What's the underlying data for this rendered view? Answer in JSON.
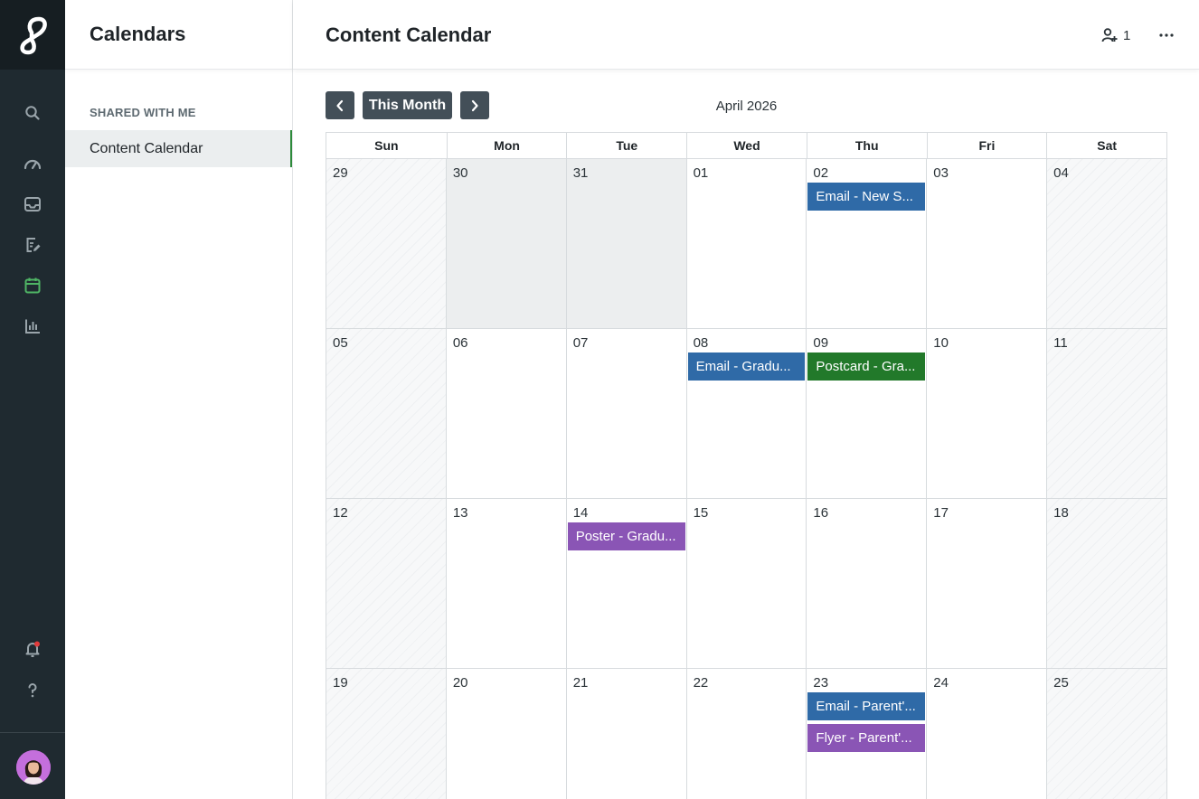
{
  "sidebar": {
    "title": "Calendars",
    "section_label": "SHARED WITH ME",
    "items": [
      {
        "label": "Content Calendar"
      }
    ]
  },
  "rail": {
    "icons": [
      "logo-icon",
      "search-icon",
      "dashboard-gauge-icon",
      "inbox-icon",
      "edit-document-icon",
      "calendar-icon",
      "bar-chart-icon",
      "notification-bell-icon",
      "help-icon"
    ],
    "active_icon": "calendar-icon",
    "active_color": "#4fb565"
  },
  "header": {
    "title": "Content Calendar",
    "share_count": "1"
  },
  "toolbar": {
    "prev_icon": "chevron-left-icon",
    "this_month_label": "This Month",
    "next_icon": "chevron-right-icon",
    "month_label": "April 2026"
  },
  "calendar": {
    "weekdays": [
      "Sun",
      "Mon",
      "Tue",
      "Wed",
      "Thu",
      "Fri",
      "Sat"
    ],
    "weeks": [
      [
        {
          "day": "29",
          "type": "weekend",
          "events": []
        },
        {
          "day": "30",
          "type": "past",
          "events": []
        },
        {
          "day": "31",
          "type": "past",
          "events": []
        },
        {
          "day": "01",
          "type": "normal",
          "events": []
        },
        {
          "day": "02",
          "type": "normal",
          "events": [
            {
              "label": "Email - New S...",
              "color": "blue"
            }
          ]
        },
        {
          "day": "03",
          "type": "normal",
          "events": []
        },
        {
          "day": "04",
          "type": "weekend",
          "events": []
        }
      ],
      [
        {
          "day": "05",
          "type": "weekend",
          "events": []
        },
        {
          "day": "06",
          "type": "normal",
          "events": []
        },
        {
          "day": "07",
          "type": "normal",
          "events": []
        },
        {
          "day": "08",
          "type": "normal",
          "events": [
            {
              "label": "Email - Gradu...",
              "color": "blue"
            }
          ]
        },
        {
          "day": "09",
          "type": "normal",
          "events": [
            {
              "label": "Postcard - Gra...",
              "color": "green"
            }
          ]
        },
        {
          "day": "10",
          "type": "normal",
          "events": []
        },
        {
          "day": "11",
          "type": "weekend",
          "events": []
        }
      ],
      [
        {
          "day": "12",
          "type": "weekend",
          "events": []
        },
        {
          "day": "13",
          "type": "normal",
          "events": []
        },
        {
          "day": "14",
          "type": "normal",
          "events": [
            {
              "label": "Poster - Gradu...",
              "color": "purple"
            }
          ]
        },
        {
          "day": "15",
          "type": "normal",
          "events": []
        },
        {
          "day": "16",
          "type": "normal",
          "events": []
        },
        {
          "day": "17",
          "type": "normal",
          "events": []
        },
        {
          "day": "18",
          "type": "weekend",
          "events": []
        }
      ],
      [
        {
          "day": "19",
          "type": "weekend",
          "events": []
        },
        {
          "day": "20",
          "type": "normal",
          "events": []
        },
        {
          "day": "21",
          "type": "normal",
          "events": []
        },
        {
          "day": "22",
          "type": "normal",
          "events": []
        },
        {
          "day": "23",
          "type": "normal",
          "events": [
            {
              "label": "Email - Parent'...",
              "color": "blue"
            },
            {
              "label": "Flyer - Parent'...",
              "color": "purple"
            }
          ]
        },
        {
          "day": "24",
          "type": "normal",
          "events": []
        },
        {
          "day": "25",
          "type": "weekend",
          "events": []
        }
      ]
    ]
  },
  "colors": {
    "event_blue": "#2f6aa7",
    "event_green": "#22792a",
    "event_purple": "#8a55b5",
    "button_dark": "#434f58",
    "selected_indicator": "#2e8a3b"
  }
}
